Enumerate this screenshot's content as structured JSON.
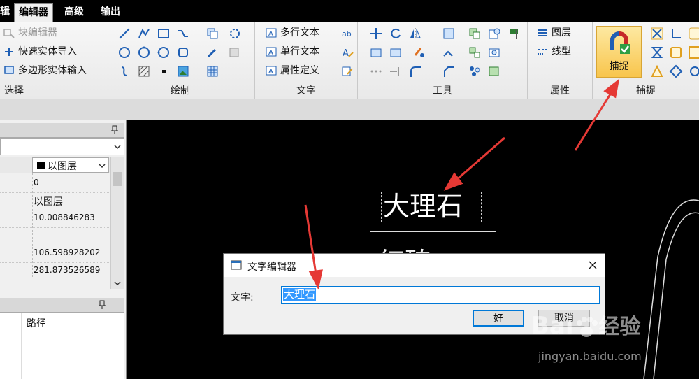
{
  "menu": {
    "tabs": [
      {
        "label": "辑"
      },
      {
        "label": "编辑器"
      },
      {
        "label": "高级"
      },
      {
        "label": "输出"
      }
    ]
  },
  "ribbon": {
    "select": {
      "label": "选择",
      "items": [
        "块编辑器",
        "快速实体导入",
        "多边形实体输入"
      ]
    },
    "draw": {
      "label": "绘制"
    },
    "text": {
      "label": "文字",
      "items": [
        "多行文本",
        "单行文本",
        "属性定义"
      ]
    },
    "tools": {
      "label": "工具"
    },
    "props": {
      "label": "属性",
      "items": [
        "图层",
        "线型"
      ]
    },
    "snap": {
      "label": "捕捉",
      "button_label": "捕捉"
    }
  },
  "props_panel": {
    "color_value": "以图层",
    "rows": [
      "0",
      "以图层",
      "10.008846283",
      "",
      "106.598928202",
      "281.873526589"
    ]
  },
  "bottom_panel": {
    "column_header": "路径"
  },
  "canvas": {
    "text_primary": "大理石",
    "text_secondary": "红砖"
  },
  "dialog": {
    "title": "文字编辑器",
    "field_label": "文字:",
    "field_value": "大理石",
    "ok_label": "好",
    "cancel_label": "取消"
  },
  "watermark": {
    "brand": "Bai",
    "brand2": "经验",
    "url": "jingyan.baidu.com"
  },
  "colors": {
    "accent_arrow": "#e53935",
    "selection": "#3399ff",
    "snap_highlight": "#f8c54c"
  }
}
